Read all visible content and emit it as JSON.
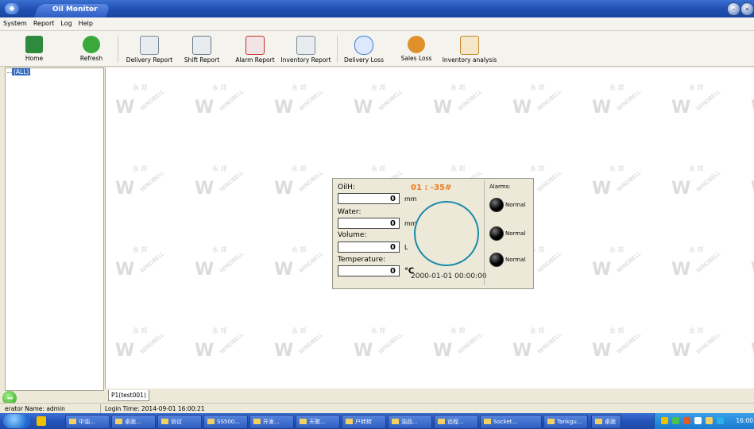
{
  "window": {
    "title": "Oil Monitor"
  },
  "menu": [
    "System",
    "Report",
    "Log",
    "Help"
  ],
  "toolbar": [
    {
      "label": "Home",
      "icon": "home-icon",
      "color": "#2e8b3e"
    },
    {
      "label": "Refresh",
      "icon": "refresh-icon",
      "color": "#3aa83a"
    },
    {
      "label": "Delivery Report",
      "icon": "report-icon",
      "color": "#7a8a99"
    },
    {
      "label": "Shift Report",
      "icon": "shift-report-icon",
      "color": "#6a7a88"
    },
    {
      "label": "Alarm Report",
      "icon": "alarm-report-icon",
      "color": "#c23030"
    },
    {
      "label": "Inventory Report",
      "icon": "inventory-report-icon",
      "color": "#7a8a99"
    },
    {
      "label": "Delivery Loss",
      "icon": "clock-icon",
      "color": "#3a7ad8"
    },
    {
      "label": "Sales Loss",
      "icon": "sales-loss-icon",
      "color": "#e0902a"
    },
    {
      "label": "Inventory analysis",
      "icon": "analysis-icon",
      "color": "#c0882a"
    }
  ],
  "tree": {
    "root": "(ALL)"
  },
  "watermark": {
    "cn": "永 邦",
    "en": "WINDBELL",
    "mark": "W"
  },
  "tank_panel": {
    "tank_id": "01 : -35#",
    "fields": [
      {
        "label": "OilH:",
        "value": "0",
        "unit": "mm"
      },
      {
        "label": "Water:",
        "value": "0",
        "unit": "mm"
      },
      {
        "label": "Volume:",
        "value": "0",
        "unit": "L"
      },
      {
        "label": "Temperature:",
        "value": "0",
        "unit": "℃"
      }
    ],
    "timestamp": "2000-01-01 00:00:00",
    "alarms_label": "Alarms:",
    "alarms": [
      "Normal",
      "Normal",
      "Normal"
    ]
  },
  "tabs": [
    "P1(test001)"
  ],
  "status": {
    "operator": "erator Name: admin",
    "login": "Login Time: 2014-09-01 16:00:21"
  },
  "taskbar": {
    "items": [
      "中油...",
      "桌面...",
      "协议",
      "SS500...",
      "开发...",
      "天歌...",
      "户转转",
      "油品...",
      "远程...",
      "Socket...",
      "Tankgu...",
      "桌面"
    ],
    "clock": "16:00"
  }
}
